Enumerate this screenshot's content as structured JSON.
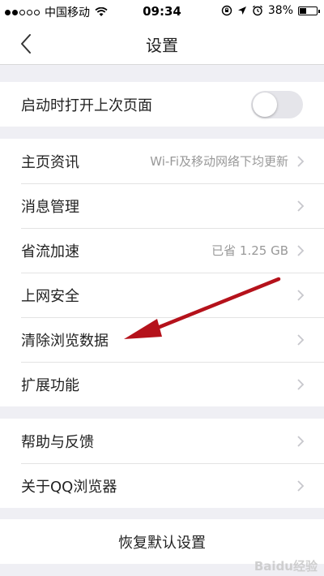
{
  "status": {
    "carrier": "中国移动",
    "time": "09:34",
    "battery": "38%",
    "battery_level": 0.38,
    "icons": [
      "signal-dots-icon",
      "wifi-icon",
      "rotation-lock-icon",
      "location-icon",
      "alarm-icon",
      "battery-icon"
    ]
  },
  "nav": {
    "title": "设置",
    "back_icon": "back-chevron-icon"
  },
  "groups": {
    "startup": {
      "label": "启动时打开上次页面",
      "toggle_on": false
    },
    "main": [
      {
        "label": "主页资讯",
        "value": "Wi-Fi及移动网络下均更新"
      },
      {
        "label": "消息管理",
        "value": ""
      },
      {
        "label": "省流加速",
        "value": "已省 1.25 GB"
      },
      {
        "label": "上网安全",
        "value": ""
      },
      {
        "label": "清除浏览数据",
        "value": ""
      },
      {
        "label": "扩展功能",
        "value": ""
      }
    ],
    "help": [
      {
        "label": "帮助与反馈"
      },
      {
        "label": "关于QQ浏览器"
      }
    ],
    "reset": {
      "label": "恢复默认设置"
    }
  },
  "annotation": {
    "arrow_color": "#b5121b",
    "arrow_target": "清除浏览数据"
  },
  "watermark": "Baidu经验"
}
